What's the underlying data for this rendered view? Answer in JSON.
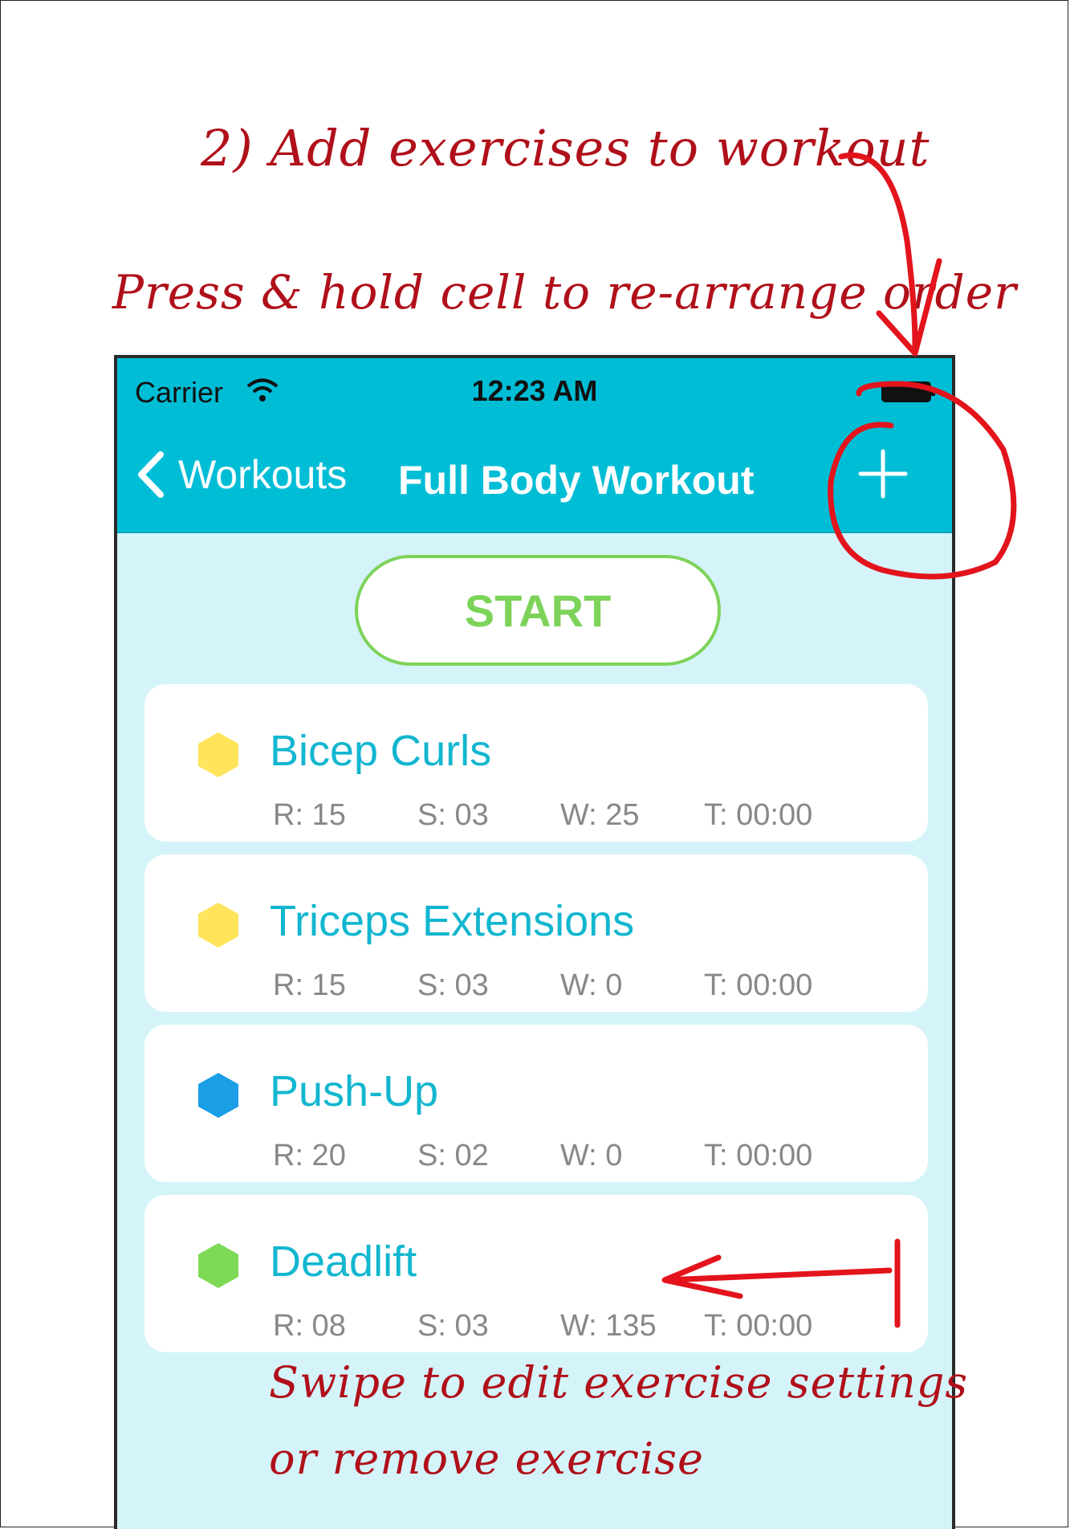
{
  "annotations": {
    "add_exercises": "2) Add exercises to workout",
    "press_hold": "Press & hold cell to re-arrange order",
    "swipe_line1": "Swipe to edit exercise settings",
    "swipe_line2": "or remove exercise"
  },
  "status_bar": {
    "carrier": "Carrier",
    "time": "12:23 AM"
  },
  "nav": {
    "back_label": "Workouts",
    "title": "Full Body Workout",
    "add_icon": "plus-icon"
  },
  "start_button": {
    "label": "START"
  },
  "exercises": [
    {
      "name": "Bicep Curls",
      "color": "#ffe45c",
      "reps": "R: 15",
      "sets": "S: 03",
      "weight": "W: 25",
      "time": "T: 00:00"
    },
    {
      "name": "Triceps Extensions",
      "color": "#ffe45c",
      "reps": "R: 15",
      "sets": "S: 03",
      "weight": "W: 0",
      "time": "T: 00:00"
    },
    {
      "name": "Push-Up",
      "color": "#1a9ee6",
      "reps": "R: 20",
      "sets": "S: 02",
      "weight": "W: 0",
      "time": "T: 00:00"
    },
    {
      "name": "Deadlift",
      "color": "#7ed957",
      "reps": "R: 08",
      "sets": "S: 03",
      "weight": "W: 135",
      "time": "T: 00:00"
    }
  ],
  "colors": {
    "header": "#00bdd6",
    "background": "#d5f4fa",
    "accent_green": "#7dd35a",
    "annotation_red": "#b0101a"
  }
}
